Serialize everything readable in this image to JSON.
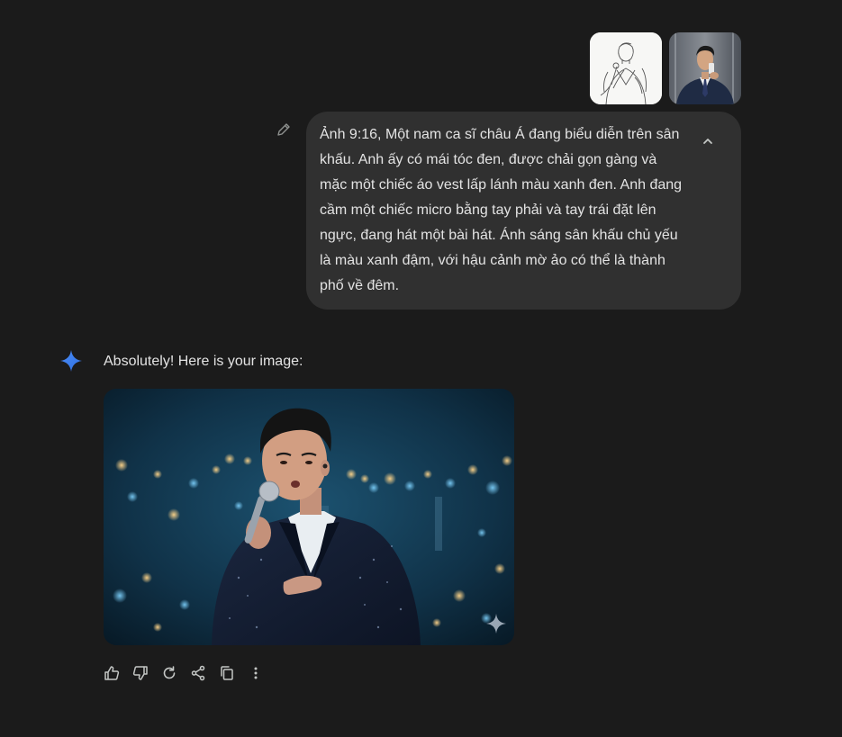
{
  "user_turn": {
    "attachments": [
      {
        "kind": "sketch",
        "icon": "line-drawing-singer-thumbnail"
      },
      {
        "kind": "photo",
        "icon": "man-in-suit-selfie-thumbnail"
      }
    ],
    "edit_icon": "pencil-icon",
    "prompt": "Ảnh 9:16, Một nam ca sĩ châu Á đang biểu diễn trên sân\nkhấu. Anh ấy có mái tóc đen, được chải gọn gàng và\nmặc một chiếc áo vest lấp lánh màu xanh đen. Anh đang\ncầm một chiếc micro bằng tay phải và tay trái đặt lên\nngực, đang hát một bài hát. Ánh sáng sân khấu chủ yếu\nlà màu xanh đậm, với hậu cảnh mờ ảo có thể là thành\nphố về đêm.",
    "collapse_icon": "chevron-up-icon"
  },
  "model_turn": {
    "avatar_icon": "gemini-spark-icon",
    "text": "Absolutely! Here is your image:",
    "image_icon": "generated-singer-image",
    "actions": [
      {
        "name": "thumbs-up",
        "icon": "thumbs-up-icon"
      },
      {
        "name": "thumbs-down",
        "icon": "thumbs-down-icon"
      },
      {
        "name": "regenerate",
        "icon": "refresh-icon"
      },
      {
        "name": "share",
        "icon": "share-icon"
      },
      {
        "name": "copy",
        "icon": "copy-icon"
      },
      {
        "name": "more",
        "icon": "more-vertical-icon"
      }
    ]
  },
  "colors": {
    "background": "#1b1b1b",
    "bubble": "#303030",
    "text": "#e3e3e3",
    "icon": "#c4c7c5",
    "accent": "#4b8df8"
  }
}
